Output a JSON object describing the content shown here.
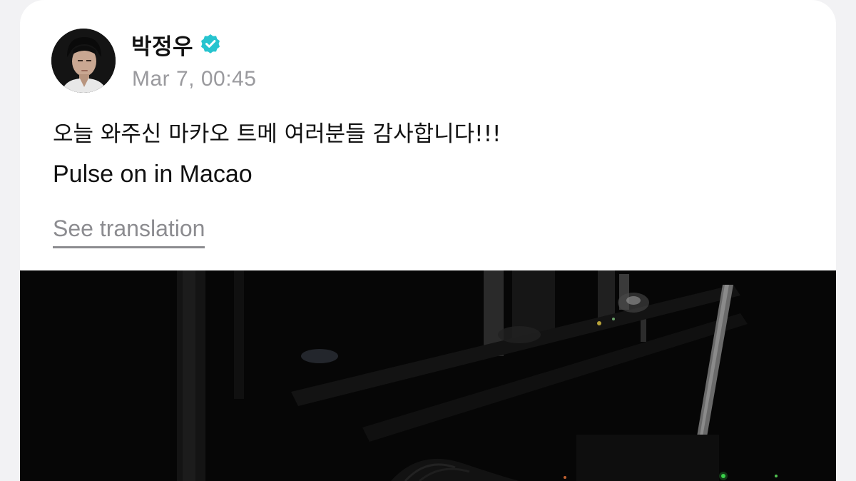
{
  "post": {
    "author_name": "박정우",
    "verified_icon": "verified-badge-icon",
    "timestamp": "Mar 7, 00:45",
    "text_lines": [
      "오늘 와주신 마카오 트메 여러분들 감사합니다!!!",
      "Pulse on in Macao"
    ],
    "translate_label": "See translation",
    "avatar": "profile-photo",
    "media": "dark-backstage-photo"
  },
  "colors": {
    "verified": "#27c4cf",
    "background": "#f2f2f4",
    "card": "#ffffff",
    "text": "#111111",
    "muted": "#9a9a9e"
  }
}
